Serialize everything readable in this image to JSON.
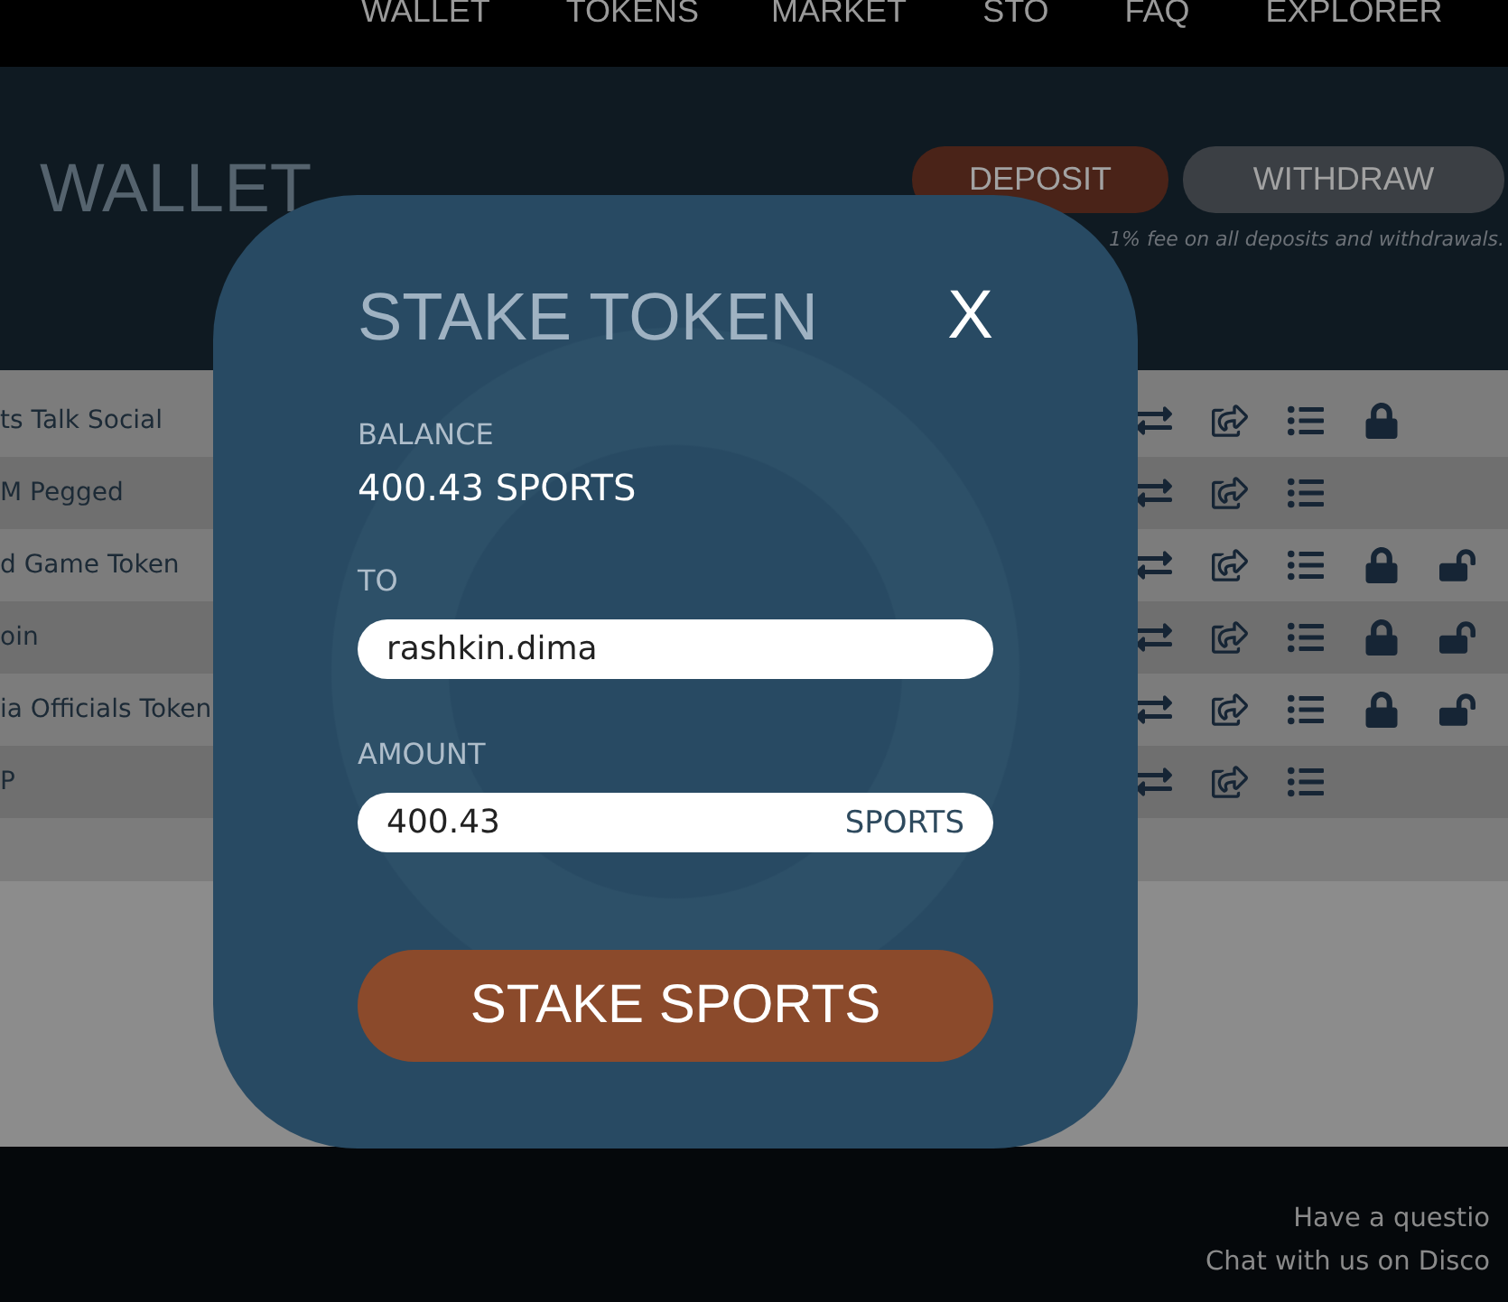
{
  "nav": {
    "items": [
      "WALLET",
      "TOKENS",
      "MARKET",
      "STO",
      "FAQ",
      "EXPLORER"
    ]
  },
  "header": {
    "title": "WALLET",
    "buttons": [
      {
        "label": "DEPOSIT",
        "kind": "primary"
      },
      {
        "label": "WITHDRAW",
        "kind": "secondary"
      }
    ],
    "note": "1% fee on all deposits and withdrawals."
  },
  "tokens": [
    {
      "name": "ts Talk Social",
      "lock": true,
      "unlock": false
    },
    {
      "name": "M Pegged",
      "lock": false,
      "unlock": false
    },
    {
      "name": "d Game Token",
      "lock": true,
      "unlock": true
    },
    {
      "name": "oin",
      "lock": true,
      "unlock": true
    },
    {
      "name": "ia Officials Token",
      "lock": true,
      "unlock": true
    },
    {
      "name": "P",
      "lock": false,
      "unlock": false
    }
  ],
  "footer": {
    "lines": [
      "Have a questio",
      "Chat with us on Disco"
    ]
  },
  "modal": {
    "title": "STAKE TOKEN",
    "close": "X",
    "balance_label": "BALANCE",
    "balance": "400.43 SPORTS",
    "to_label": "TO",
    "to_value": "rashkin.dima",
    "amount_label": "AMOUNT",
    "amount_value": "400.43",
    "amount_unit": "SPORTS",
    "submit": "STAKE SPORTS"
  }
}
